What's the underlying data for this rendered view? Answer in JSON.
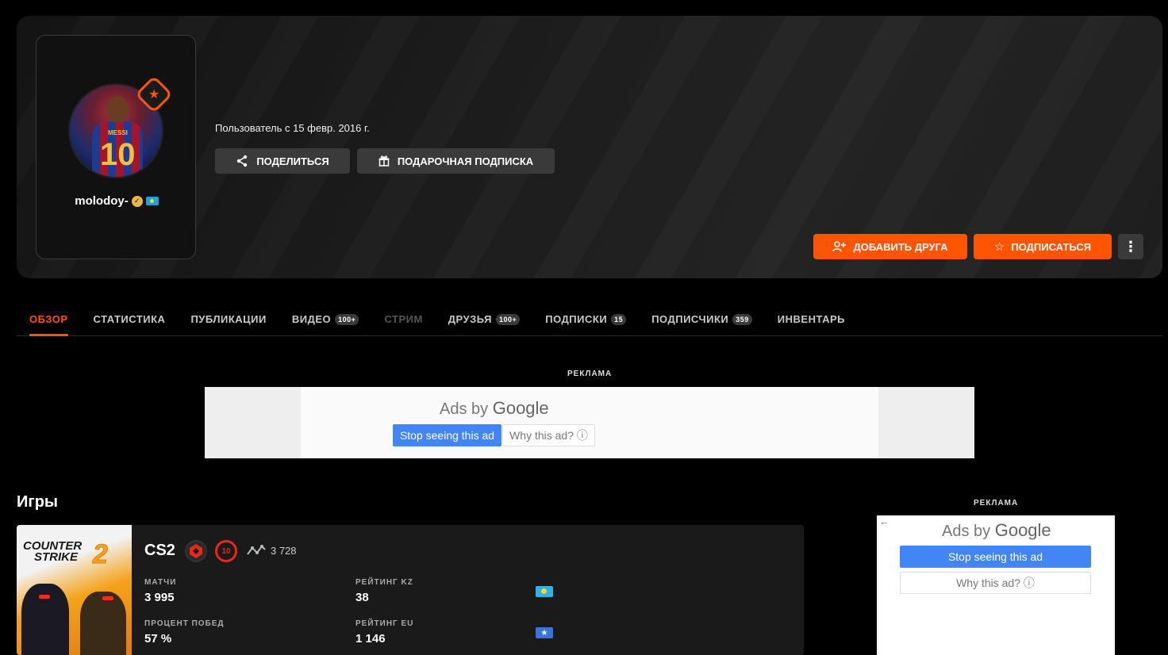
{
  "profile": {
    "username": "molodoy-",
    "member_since": "Пользователь с 15 февр. 2016 г.",
    "avatar_shirt_name": "MESSI",
    "avatar_shirt_number": "10"
  },
  "actions": {
    "share_label": "ПОДЕЛИТЬСЯ",
    "gift_label": "ПОДАРОЧНАЯ ПОДПИСКА",
    "add_friend_label": "ДОБАВИТЬ ДРУГА",
    "follow_label": "ПОДПИСАТЬСЯ"
  },
  "tabs": [
    {
      "label": "ОБЗОР",
      "badge": "",
      "state": "active"
    },
    {
      "label": "СТАТИСТИКА",
      "badge": "",
      "state": "normal"
    },
    {
      "label": "ПУБЛИКАЦИИ",
      "badge": "",
      "state": "normal"
    },
    {
      "label": "ВИДЕО",
      "badge": "100+",
      "state": "normal"
    },
    {
      "label": "СТРИМ",
      "badge": "",
      "state": "disabled"
    },
    {
      "label": "ДРУЗЬЯ",
      "badge": "100+",
      "state": "normal"
    },
    {
      "label": "ПОДПИСКИ",
      "badge": "15",
      "state": "normal"
    },
    {
      "label": "ПОДПИСЧИКИ",
      "badge": "359",
      "state": "normal"
    },
    {
      "label": "ИНВЕНТАРЬ",
      "badge": "",
      "state": "normal"
    }
  ],
  "ads": {
    "label": "РЕКЛАМА",
    "ads_by": "Ads by",
    "google": "Google",
    "stop_label": "Stop seeing this ad",
    "why_label": "Why this ad? ⓘ"
  },
  "games": {
    "title": "Игры",
    "items": [
      {
        "art_logo_line1": "COUNTER",
        "art_logo_line2": "STRIKE",
        "art_logo_num": "2",
        "name": "CS2",
        "level": "10",
        "elo": "3 728",
        "stats": {
          "matches_label": "МАТЧИ",
          "matches_value": "3 995",
          "winrate_label": "ПРОЦЕНТ ПОБЕД",
          "winrate_value": "57 %",
          "rating_kz_label": "РЕЙТИНГ KZ",
          "rating_kz_value": "38",
          "rating_eu_label": "РЕЙТИНГ EU",
          "rating_eu_value": "1 146"
        }
      }
    ]
  },
  "colors": {
    "accent": "#ff5500",
    "background": "#000000",
    "card": "#1a1a1a",
    "google_blue": "#4285f4"
  }
}
